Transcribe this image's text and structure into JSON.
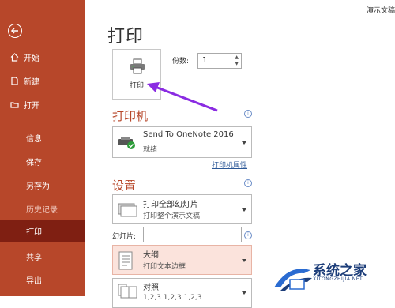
{
  "app_title": "演示文稿",
  "sidebar": {
    "items": [
      {
        "label": "开始",
        "icon": "home-icon"
      },
      {
        "label": "新建",
        "icon": "new-file-icon"
      },
      {
        "label": "打开",
        "icon": "folder-open-icon"
      },
      {
        "label": "信息"
      },
      {
        "label": "保存"
      },
      {
        "label": "另存为"
      },
      {
        "label": "历史记录"
      },
      {
        "label": "打印"
      },
      {
        "label": "共享"
      },
      {
        "label": "导出"
      }
    ],
    "active_item": "打印"
  },
  "main": {
    "title": "打印",
    "print_button_label": "打印",
    "copies_label": "份数:",
    "copies_value": "1",
    "printer_section": {
      "title": "打印机",
      "printer_name": "Send To OneNote 2016",
      "printer_status": "就绪",
      "printer_properties_link": "打印机属性"
    },
    "settings_section": {
      "title": "设置",
      "range": {
        "line1": "打印全部幻灯片",
        "line2": "打印整个演示文稿"
      },
      "slides_label": "幻灯片:",
      "slides_value": "",
      "layout": {
        "line1": "大纲",
        "line2": "打印文本边框"
      },
      "collation": {
        "line1": "对照",
        "line2": "1,2,3    1,2,3    1,2,3"
      }
    }
  },
  "watermark": {
    "text": "系统之家",
    "subtext": "XITONGZHIJIA.NET"
  },
  "colors": {
    "sidebar_bg": "#b7472a",
    "sidebar_active": "#7f1f12",
    "accent": "#b7472a",
    "highlight_bg": "#fbe3dc",
    "annotation_arrow": "#8a2be2"
  }
}
